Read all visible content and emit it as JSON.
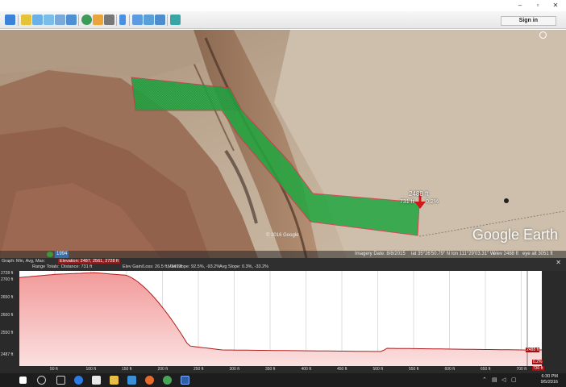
{
  "window": {
    "minimize": "–",
    "maximize": "▫",
    "close": "✕"
  },
  "toolbar": {
    "sign_in": "Sign in",
    "buttons": [
      "sidebar",
      "placemark",
      "polygon",
      "path",
      "image-overlay",
      "record-tour",
      "historical-imagery",
      "sun",
      "planets",
      "ruler",
      "email",
      "print",
      "save-image",
      "maps"
    ]
  },
  "map": {
    "logo": "Google Earth",
    "copyright": "© 2016 Google",
    "cursor_elevation": "2488 ft",
    "cursor_distance": "731 ft",
    "cursor_slope": "0.2%",
    "year_badge": "1994",
    "status": {
      "imagery_date": "Imagery Date: 8/8/2015",
      "lat": "lat 35°26'50.79\" N",
      "lon": "lon 111°29'03.31\" W",
      "elev": "elev 2488 ft",
      "eye_alt": "eye alt 3051 ft"
    }
  },
  "profile": {
    "info": {
      "graph_label": "Graph:",
      "min_avg_max": "Min, Avg, Max:",
      "elevation": "Elevation: 2487, 2561, 2728 ft",
      "range_totals": "Range Totals:",
      "distance": "Distance: 731 ft",
      "elev_gain_loss": "Elev Gain/Loss: 26.5 ft, -249 ft",
      "max_slope": "Max Slope: 92.5%, -93.2%",
      "avg_slope": "Avg Slope: 0.3%, -33.2%"
    },
    "close": "✕",
    "end_elev": "2488 ft",
    "end_slope": "0.2%",
    "end_dist": "730 ft",
    "y_ticks": [
      "2728 ft",
      "2700 ft",
      "2650 ft",
      "2600 ft",
      "2550 ft",
      "2487 ft"
    ],
    "x_ticks": [
      "50 ft",
      "100 ft",
      "150 ft",
      "200 ft",
      "250 ft",
      "300 ft",
      "350 ft",
      "400 ft",
      "450 ft",
      "500 ft",
      "550 ft",
      "600 ft",
      "650 ft",
      "700 ft"
    ]
  },
  "taskbar": {
    "time": "6:30 PM",
    "date": "9/5/2016",
    "apps": [
      "start",
      "search",
      "task-view",
      "edge",
      "store",
      "explorer",
      "firefox",
      "chrome",
      "google-earth",
      "photoshop"
    ]
  }
}
